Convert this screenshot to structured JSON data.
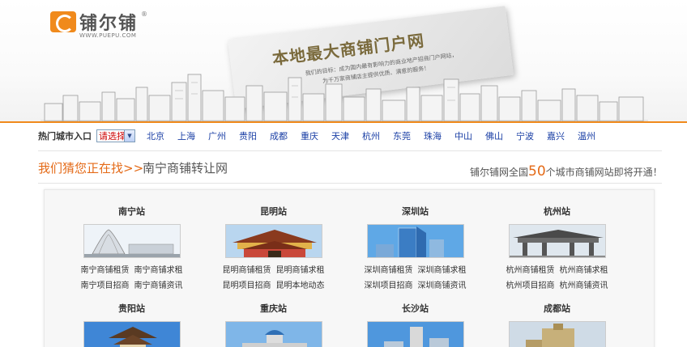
{
  "header": {
    "logo_text": "铺尔铺",
    "logo_reg": "®",
    "logo_url": "WWW.PUEPU.COM",
    "card_title": "本地最大商铺门户网",
    "card_sub1": "我们的目标：成为国内最有影响力的商业地产招商门户网站，",
    "card_sub2": "为千万家商铺店主提供优质、满意的服务！"
  },
  "citybar": {
    "label": "热门城市入口",
    "select_value": "请选择",
    "cities": [
      "北京",
      "上海",
      "广州",
      "贵阳",
      "成都",
      "重庆",
      "天津",
      "杭州",
      "东莞",
      "珠海",
      "中山",
      "佛山",
      "宁波",
      "嘉兴",
      "温州"
    ]
  },
  "guess": {
    "prefix": "我们猜您正在找>>",
    "target": "南宁商铺转让网"
  },
  "notice": {
    "before": "铺尔铺网全国",
    "number": "50",
    "after": "个城市商铺网站即将开通！"
  },
  "stations": [
    {
      "title": "南宁站",
      "links": [
        "南宁商铺租赁",
        "南宁商铺求租",
        "南宁项目招商",
        "南宁商铺资讯"
      ]
    },
    {
      "title": "昆明站",
      "links": [
        "昆明商铺租赁",
        "昆明商铺求租",
        "昆明项目招商",
        "昆明本地动态"
      ]
    },
    {
      "title": "深圳站",
      "links": [
        "深圳商铺租赁",
        "深圳商铺求租",
        "深圳项目招商",
        "深圳商铺资讯"
      ]
    },
    {
      "title": "杭州站",
      "links": [
        "杭州商铺租赁",
        "杭州商铺求租",
        "杭州项目招商",
        "杭州商铺资讯"
      ]
    },
    {
      "title": "贵阳站",
      "links": []
    },
    {
      "title": "重庆站",
      "links": []
    },
    {
      "title": "长沙站",
      "links": []
    },
    {
      "title": "成都站",
      "links": []
    }
  ],
  "colors": {
    "accent": "#f08a1c",
    "link": "#1a3fa5",
    "highlight": "#e46a17"
  }
}
